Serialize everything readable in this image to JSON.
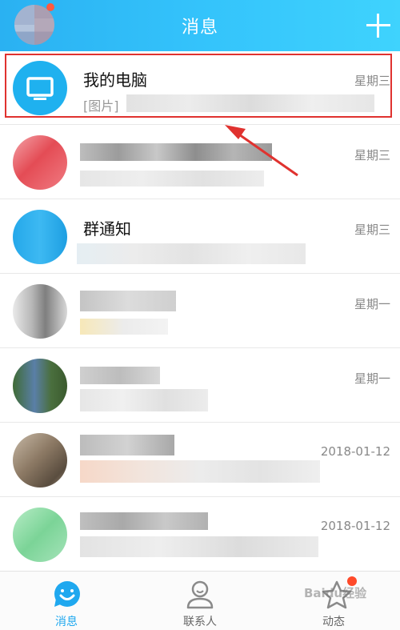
{
  "header": {
    "title": "消息"
  },
  "chats": [
    {
      "name": "我的电脑",
      "preview": "[图片]",
      "time": "星期三"
    },
    {
      "name": "",
      "preview": "",
      "time": "星期三"
    },
    {
      "name": "群通知",
      "preview": "",
      "time": "星期三"
    },
    {
      "name": "",
      "preview": "",
      "time": "星期一"
    },
    {
      "name": "",
      "preview": "",
      "time": "星期一"
    },
    {
      "name": "",
      "preview": "",
      "time": "2018-01-12"
    },
    {
      "name": "",
      "preview": "",
      "time": "2018-01-12"
    }
  ],
  "tabs": [
    {
      "label": "消息",
      "icon": "smiley-bubble-icon",
      "active": true
    },
    {
      "label": "联系人",
      "icon": "person-icon",
      "active": false
    },
    {
      "label": "动态",
      "icon": "star-icon",
      "active": false
    }
  ],
  "watermark": "Baidu经验",
  "colors": {
    "header": "#34c3fb",
    "accent": "#1fa8ef",
    "highlight": "#e0322f",
    "badge": "#ff4a2a"
  }
}
